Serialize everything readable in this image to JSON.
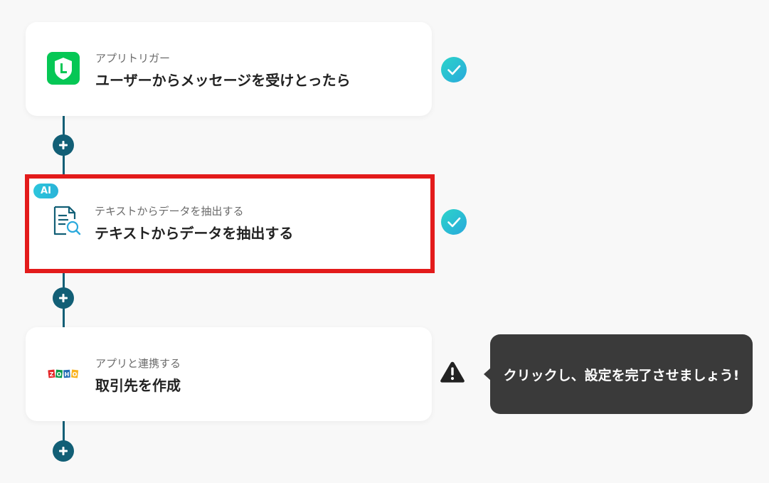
{
  "flow": {
    "steps": [
      {
        "kind": "trigger",
        "app_icon": "line-icon",
        "subtitle": "アプリトリガー",
        "title": "ユーザーからメッセージを受けとったら",
        "status": "complete",
        "selected": false
      },
      {
        "kind": "ai-action",
        "badge": "AI",
        "app_icon": "document-search-icon",
        "subtitle": "テキストからデータを抽出する",
        "title": "テキストからデータを抽出する",
        "status": "complete",
        "selected": true
      },
      {
        "kind": "app-action",
        "app_icon": "zoho-logo",
        "subtitle": "アプリと連携する",
        "title": "取引先を作成",
        "status": "warning",
        "selected": false
      }
    ]
  },
  "tooltip": {
    "text": "クリックし、設定を完了させましょう!"
  },
  "logos": {
    "zoho": [
      "Z",
      "O",
      "H",
      "O"
    ]
  },
  "colors": {
    "connector": "#125f76",
    "check_gradient_start": "#2bd4c9",
    "check_gradient_end": "#2aa9dc",
    "selected_border": "#e31b1b",
    "line_green": "#06c755",
    "warning": "#222222",
    "tooltip_bg": "#3a3a3a"
  }
}
